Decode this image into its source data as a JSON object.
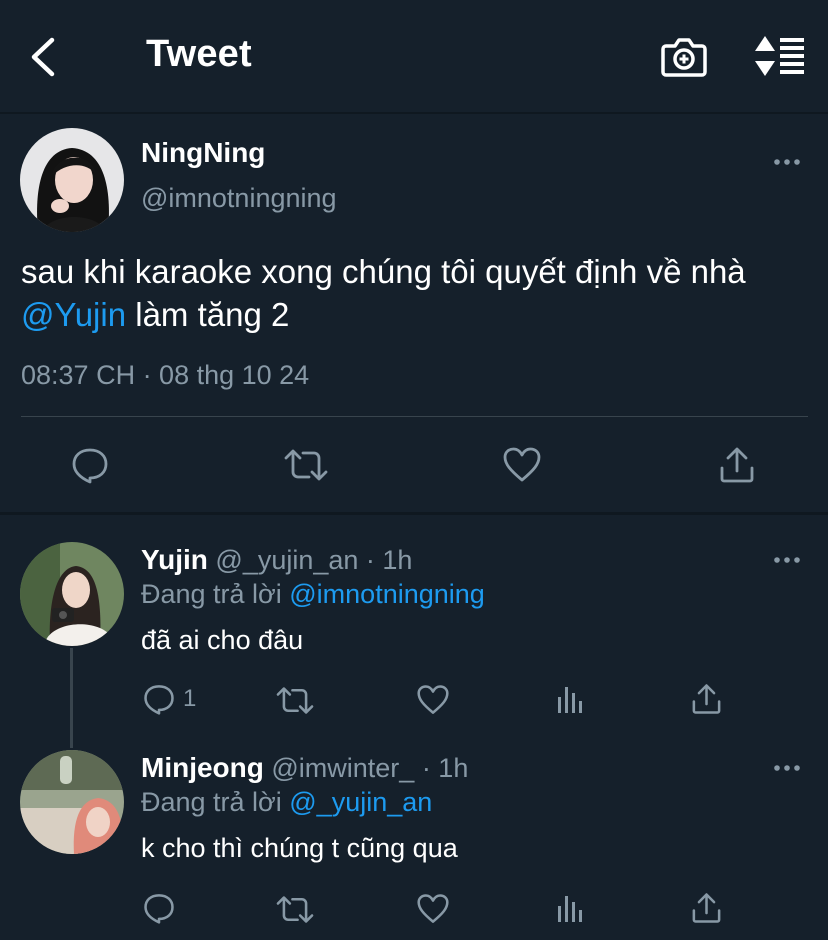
{
  "header": {
    "title": "Tweet",
    "back_icon": "chevron-left-icon",
    "camera_icon": "camera-add-icon",
    "sort_icon": "sort-icon"
  },
  "main_tweet": {
    "name": "NingNing",
    "handle": "@imnotningning",
    "text_before": "sau khi karaoke xong chúng tôi quyết định về nhà ",
    "mention": "@Yujin",
    "text_after": " làm tăng 2",
    "timestamp": "08:37 CH · 08 thg 10 24"
  },
  "replies": [
    {
      "name": "Yujin",
      "handle_time": " @_yujin_an · 1h",
      "replying_label": "Đang trả lời ",
      "replying_to": "@imnotningning",
      "text": "đã ai cho đâu",
      "reply_count": "1"
    },
    {
      "name": "Minjeong",
      "handle_time": " @imwinter_ · 1h",
      "replying_label": "Đang trả lời ",
      "replying_to": "@_yujin_an",
      "text": "k cho thì chúng t cũng qua",
      "reply_count": ""
    }
  ],
  "colors": {
    "background": "#15202b",
    "accent": "#1d9bf0",
    "secondary_text": "#8899a6"
  }
}
